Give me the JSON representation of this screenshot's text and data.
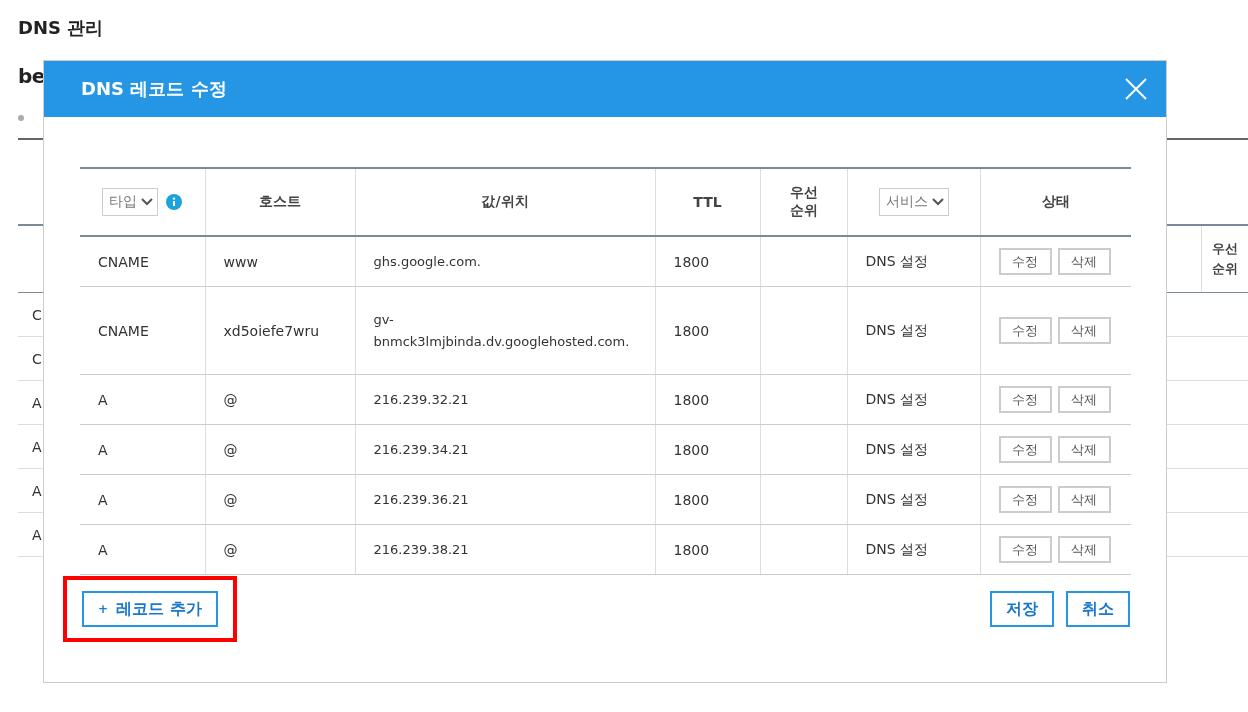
{
  "page": {
    "title": "DNS 관리",
    "heading": "be",
    "background_table": {
      "first_column": [
        "C",
        "C",
        "A",
        "A",
        "A",
        "A"
      ],
      "header": "우선 순위"
    }
  },
  "dialog": {
    "title": "DNS 레코드 수정",
    "columns": [
      {
        "kind": "select",
        "label": "타입",
        "info": true
      },
      {
        "kind": "text",
        "label": "호스트"
      },
      {
        "kind": "text",
        "label": "값/위치"
      },
      {
        "kind": "text",
        "label": "TTL"
      },
      {
        "kind": "text",
        "label": "우선 순위"
      },
      {
        "kind": "select",
        "label": "서비스",
        "info": false
      },
      {
        "kind": "text",
        "label": "상태"
      }
    ],
    "rows": [
      {
        "type": "CNAME",
        "host": "www",
        "value": "ghs.google.com.",
        "ttl": "1800",
        "service": "DNS 설정",
        "actions": [
          "수정",
          "삭제"
        ]
      },
      {
        "type": "CNAME",
        "host": "xd5oiefe7wru",
        "value": "gv-bnmck3lmjbinda.dv.googlehosted.com.",
        "ttl": "1800",
        "service": "DNS 설정",
        "actions": [
          "수정",
          "삭제"
        ]
      },
      {
        "type": "A",
        "host": "@",
        "value": "216.239.32.21",
        "ttl": "1800",
        "service": "DNS 설정",
        "actions": [
          "수정",
          "삭제"
        ]
      },
      {
        "type": "A",
        "host": "@",
        "value": "216.239.34.21",
        "ttl": "1800",
        "service": "DNS 설정",
        "actions": [
          "수정",
          "삭제"
        ]
      },
      {
        "type": "A",
        "host": "@",
        "value": "216.239.36.21",
        "ttl": "1800",
        "service": "DNS 설정",
        "actions": [
          "수정",
          "삭제"
        ]
      },
      {
        "type": "A",
        "host": "@",
        "value": "216.239.38.21",
        "ttl": "1800",
        "service": "DNS 설정",
        "actions": [
          "수정",
          "삭제"
        ]
      }
    ],
    "add_button": {
      "icon": "+",
      "label": "레코드 추가",
      "highlighted": true
    },
    "buttons": [
      "저장",
      "취소"
    ]
  }
}
